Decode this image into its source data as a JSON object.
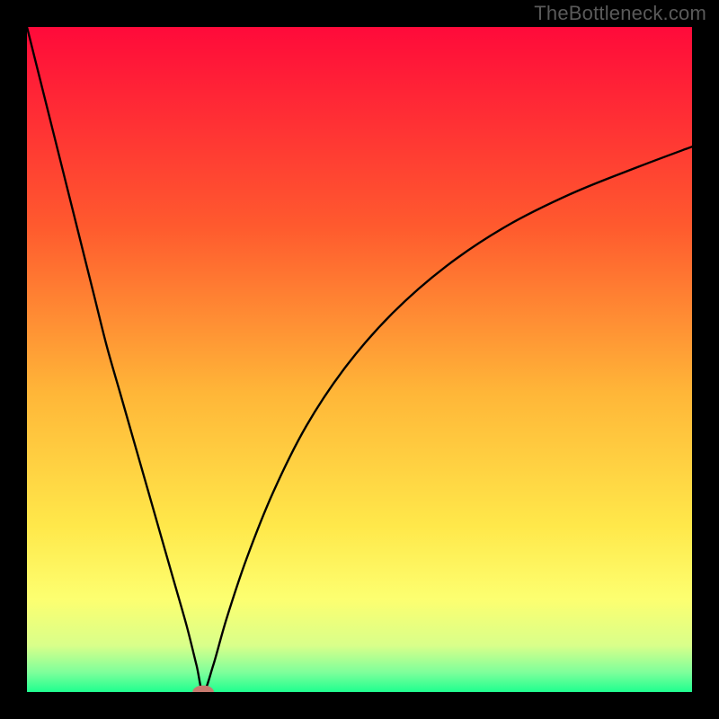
{
  "watermark": "TheBottleneck.com",
  "chart_data": {
    "type": "line",
    "title": "",
    "xlabel": "",
    "ylabel": "",
    "xlim": [
      0,
      100
    ],
    "ylim": [
      0,
      100
    ],
    "gradient_stops": [
      {
        "offset": 0,
        "color": "#ff0a3a"
      },
      {
        "offset": 30,
        "color": "#ff5a2e"
      },
      {
        "offset": 55,
        "color": "#ffb638"
      },
      {
        "offset": 75,
        "color": "#ffe84a"
      },
      {
        "offset": 86,
        "color": "#fdff70"
      },
      {
        "offset": 93,
        "color": "#d9ff8a"
      },
      {
        "offset": 97,
        "color": "#7fff9b"
      },
      {
        "offset": 100,
        "color": "#1fff8f"
      }
    ],
    "curve": {
      "x": [
        0,
        2,
        4,
        6,
        8,
        10,
        12,
        14,
        16,
        18,
        20,
        22,
        24,
        25.5,
        26.5,
        28,
        30,
        33,
        37,
        42,
        48,
        55,
        63,
        72,
        82,
        92,
        100
      ],
      "y": [
        100,
        92,
        84,
        76,
        68,
        60,
        52,
        45,
        38,
        31,
        24,
        17,
        10,
        4,
        0,
        4,
        11,
        20,
        30,
        40,
        49,
        57,
        64,
        70,
        75,
        79,
        82
      ]
    },
    "marker": {
      "x": 26.5,
      "y": 0,
      "color": "#c77a6f",
      "rx": 1.6,
      "ry": 1.0
    }
  }
}
